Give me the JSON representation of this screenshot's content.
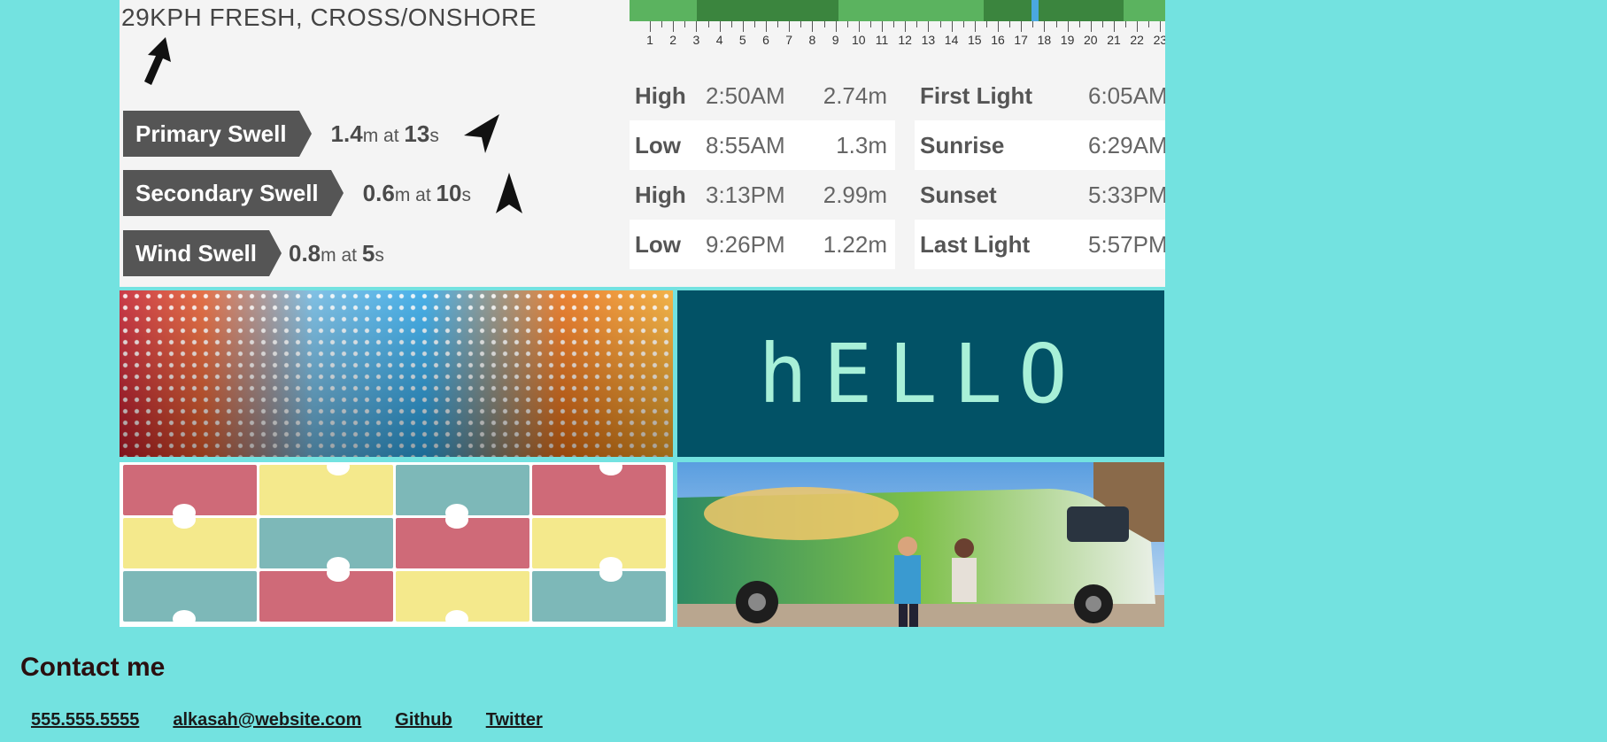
{
  "surf": {
    "wind": "29KPH FRESH, CROSS/ONSHORE",
    "swells": [
      {
        "label": "Primary Swell",
        "height": "1.4",
        "height_unit": "m",
        "at": "at",
        "period": "13",
        "period_unit": "s"
      },
      {
        "label": "Secondary Swell",
        "height": "0.6",
        "height_unit": "m",
        "at": "at",
        "period": "10",
        "period_unit": "s"
      },
      {
        "label": "Wind Swell",
        "height": "0.8",
        "height_unit": "m",
        "at": "at",
        "period": "5",
        "period_unit": "s"
      }
    ],
    "hours": [
      "1",
      "2",
      "3",
      "4",
      "5",
      "6",
      "7",
      "8",
      "9",
      "10",
      "11",
      "12",
      "13",
      "14",
      "15",
      "16",
      "17",
      "18",
      "19",
      "20",
      "21",
      "22",
      "23"
    ],
    "tides": [
      {
        "type": "High",
        "time": "2:50AM",
        "height": "2.74m"
      },
      {
        "type": "Low",
        "time": "8:55AM",
        "height": "1.3m"
      },
      {
        "type": "High",
        "time": "3:13PM",
        "height": "2.99m"
      },
      {
        "type": "Low",
        "time": "9:26PM",
        "height": "1.22m"
      }
    ],
    "lights": [
      {
        "label": "First Light",
        "time": "6:05AM"
      },
      {
        "label": "Sunrise",
        "time": "6:29AM"
      },
      {
        "label": "Sunset",
        "time": "5:33PM"
      },
      {
        "label": "Last Light",
        "time": "5:57PM"
      }
    ],
    "colors": {
      "bar_light": "#5bb35f",
      "bar_dark": "#3b853e",
      "now_marker": "#4aa8e0"
    }
  },
  "hello_text": "hELLO",
  "puzzle_colors": [
    "#cf6a78",
    "#f4e98c",
    "#7db8b8"
  ],
  "contact": {
    "title": "Contact me",
    "links": [
      "555.555.5555",
      "alkasah@website.com",
      "Github",
      "Twitter"
    ]
  }
}
